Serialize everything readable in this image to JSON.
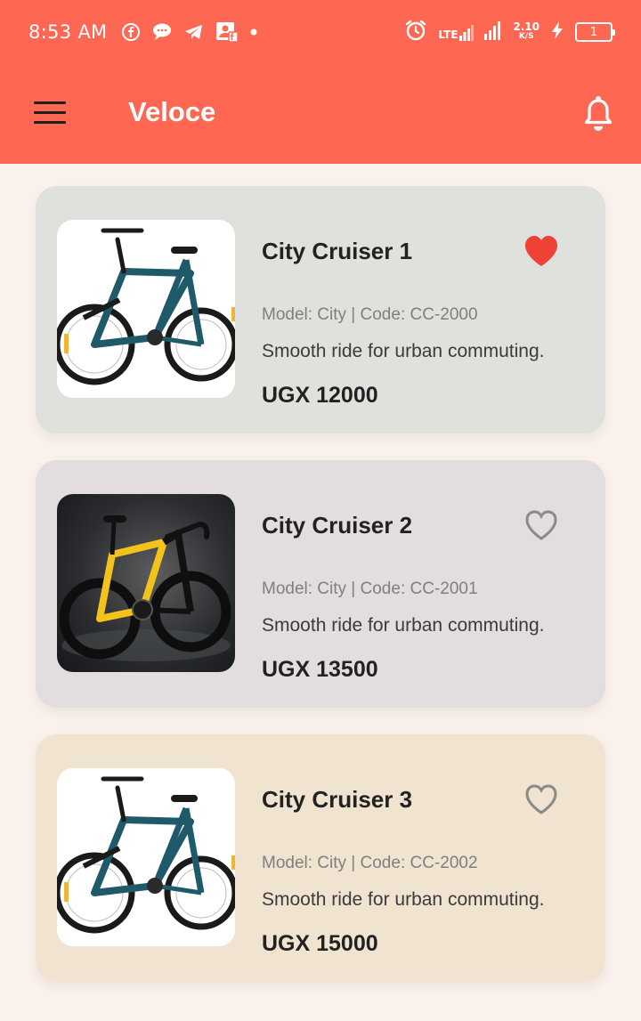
{
  "status_bar": {
    "time": "8:53 AM",
    "network": "LTE",
    "speed_value": "2.10",
    "speed_unit": "K/S",
    "battery": "1"
  },
  "app_bar": {
    "title": "Veloce",
    "menu_icon": "hamburger-menu-icon",
    "notification_icon": "bell-icon"
  },
  "colors": {
    "primary": "#fe6752",
    "background": "#fbf1ec",
    "favorite": "#f04136",
    "card_1_bg": "#dfe2dc",
    "card_2_bg": "#e2dddf",
    "card_3_bg": "#f0e4d0"
  },
  "products": [
    {
      "name": "City Cruiser 1",
      "model_code": "Model: City | Code: CC-2000",
      "description": "Smooth ride for urban commuting.",
      "price": "UGX 12000",
      "favorited": true,
      "image": "mountain-bike-blue"
    },
    {
      "name": "City Cruiser 2",
      "model_code": "Model: City | Code: CC-2001",
      "description": "Smooth ride for urban commuting.",
      "price": "UGX 13500",
      "favorited": false,
      "image": "road-bike-yellow-black"
    },
    {
      "name": "City Cruiser 3",
      "model_code": "Model: City | Code: CC-2002",
      "description": "Smooth ride for urban commuting.",
      "price": "UGX 15000",
      "favorited": false,
      "image": "mountain-bike-blue"
    }
  ]
}
